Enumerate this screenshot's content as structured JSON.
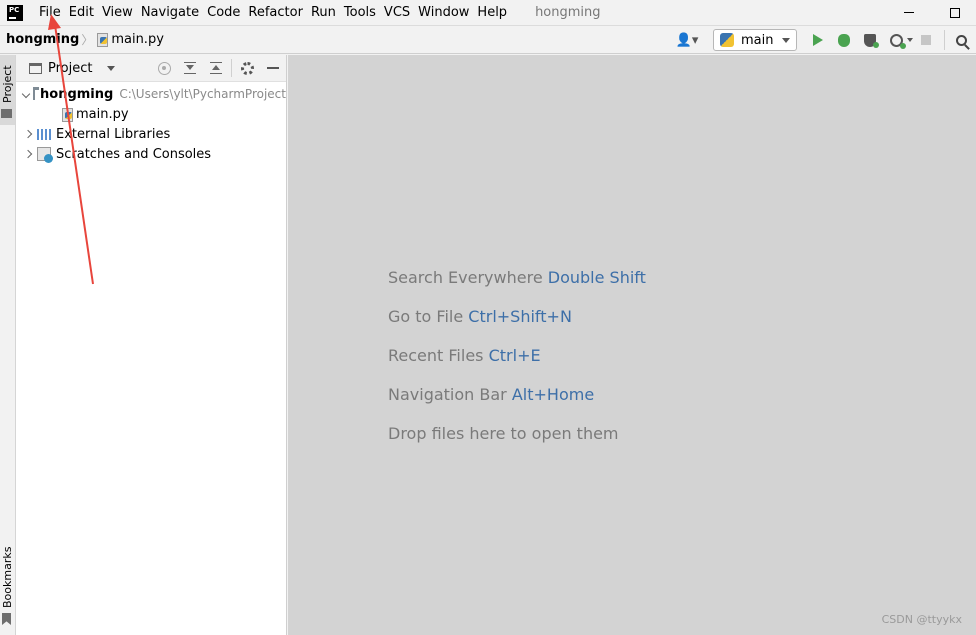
{
  "app": {
    "logo_text": "PC",
    "window_title": "hongming"
  },
  "menu": [
    "File",
    "Edit",
    "View",
    "Navigate",
    "Code",
    "Refactor",
    "Run",
    "Tools",
    "VCS",
    "Window",
    "Help"
  ],
  "navbar": {
    "breadcrumb_root": "hongming",
    "breadcrumb_file": "main.py",
    "run_config": "main"
  },
  "left_strip": {
    "project_label": "Project",
    "bookmarks_label": "Bookmarks"
  },
  "project_panel": {
    "title": "Project",
    "tree": {
      "root": {
        "label": "hongming",
        "path": "C:\\Users\\ylt\\PycharmProject"
      },
      "file": {
        "label": "main.py"
      },
      "libraries": {
        "label": "External Libraries"
      },
      "scratches": {
        "label": "Scratches and Consoles"
      }
    }
  },
  "editor": {
    "hints": [
      {
        "text": "Search Everywhere",
        "shortcut": "Double Shift"
      },
      {
        "text": "Go to File",
        "shortcut": "Ctrl+Shift+N"
      },
      {
        "text": "Recent Files",
        "shortcut": "Ctrl+E"
      },
      {
        "text": "Navigation Bar",
        "shortcut": "Alt+Home"
      },
      {
        "text": "Drop files here to open them",
        "shortcut": ""
      }
    ]
  },
  "watermark": "CSDN @ttyykx",
  "colors": {
    "annotation_arrow": "#e8453c",
    "shortcut_text": "#3d6fa8",
    "editor_bg": "#d3d3d3"
  }
}
